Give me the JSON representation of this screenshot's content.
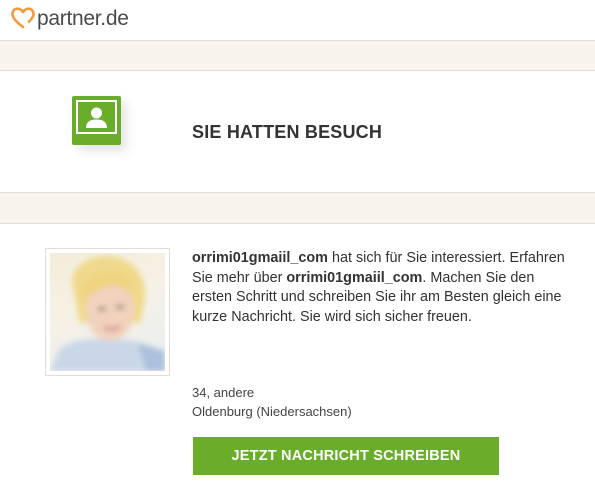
{
  "brand": {
    "logo_text": "partner.de",
    "icon": "heart-logo-icon",
    "accent_color": "#f29b3c"
  },
  "hero": {
    "icon": "user-profile-icon",
    "icon_color": "#6aad2a",
    "title": "SIE HATTEN BESUCH"
  },
  "visitor": {
    "photo": "profile-photo",
    "username": "orrimi01gmaiil_com",
    "message_part1": " hat sich für Sie interessiert. Erfahren Sie mehr über ",
    "message_part2": ". Machen Sie den ersten Schritt und schreiben Sie ihr am Besten gleich eine kurze Nachricht. Sie wird sich sicher freuen.",
    "age_line": "34, andere",
    "location": "Oldenburg (Niedersachsen)"
  },
  "cta": {
    "label": "JETZT NACHRICHT SCHREIBEN",
    "color": "#6aad2a"
  }
}
